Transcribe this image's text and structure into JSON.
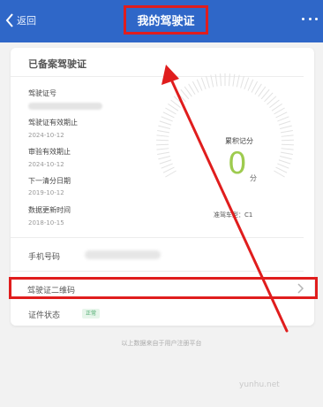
{
  "header": {
    "back_label": "返回",
    "title": "我的驾驶证"
  },
  "card": {
    "title": "已备案驾驶证",
    "fields": [
      {
        "label": "驾驶证号",
        "value": ""
      },
      {
        "label": "驾驶证有效期止",
        "value": "2024-10-12"
      },
      {
        "label": "审验有效期止",
        "value": "2024-10-12"
      },
      {
        "label": "下一清分日期",
        "value": "2019-10-12"
      },
      {
        "label": "数据更新时间",
        "value": "2018-10-15"
      }
    ],
    "score": {
      "label": "累积记分",
      "value": "0",
      "unit": "分",
      "vehicle_type": "准驾车型：C1",
      "accent_color": "#9ecb4f"
    },
    "phone_label": "手机号码",
    "qr_label": "驾驶证二维码",
    "status_label": "证件状态",
    "status_badge": "正常"
  },
  "footer_note": "以上数据来自于用户注册平台",
  "watermark": "yunhu.net",
  "colors": {
    "header_bg": "#2f67c8",
    "highlight": "#e01d1d"
  }
}
